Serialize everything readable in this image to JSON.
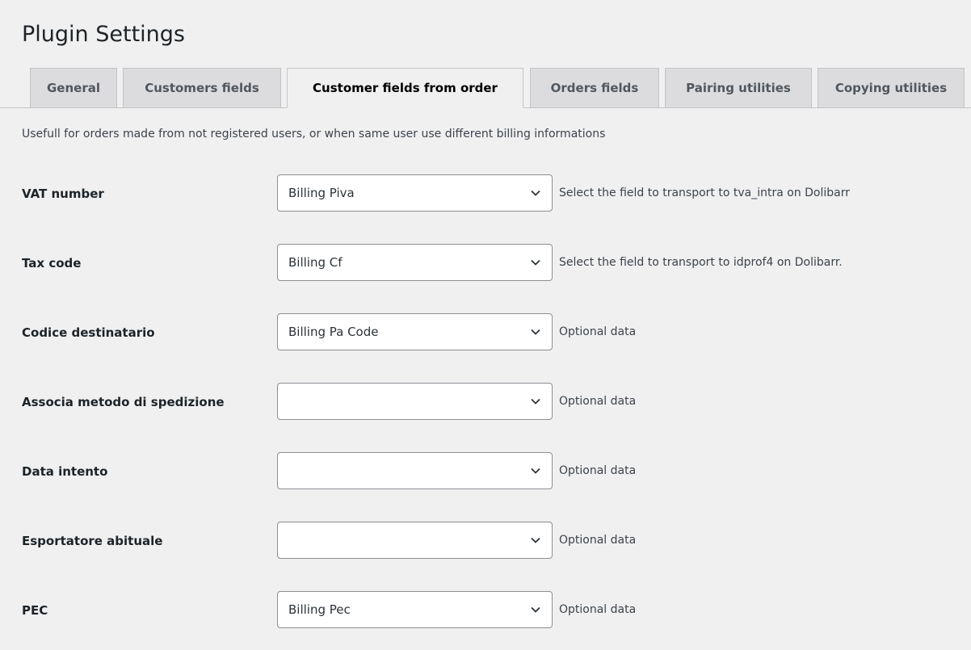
{
  "page": {
    "title": "Plugin Settings",
    "description": "Usefull for orders made from not registered users, or when same user use different billing informations"
  },
  "tabs": [
    {
      "label": "General",
      "active": false
    },
    {
      "label": "Customers fields",
      "active": false
    },
    {
      "label": "Customer fields from order",
      "active": true
    },
    {
      "label": "Orders fields",
      "active": false
    },
    {
      "label": "Pairing utilities",
      "active": false
    },
    {
      "label": "Copying utilities",
      "active": false
    }
  ],
  "fields": [
    {
      "label": "VAT number",
      "value": "Billing Piva",
      "hint": "Select the field to transport to tva_intra on Dolibarr"
    },
    {
      "label": "Tax code",
      "value": "Billing Cf",
      "hint": "Select the field to transport to idprof4 on Dolibarr."
    },
    {
      "label": "Codice destinatario",
      "value": "Billing Pa Code",
      "hint": "Optional data"
    },
    {
      "label": "Associa metodo di spedizione",
      "value": "",
      "hint": "Optional data"
    },
    {
      "label": "Data intento",
      "value": "",
      "hint": "Optional data"
    },
    {
      "label": "Esportatore abituale",
      "value": "",
      "hint": "Optional data"
    },
    {
      "label": "PEC",
      "value": "Billing Pec",
      "hint": "Optional data"
    }
  ],
  "icons": {
    "select_indicator": "chevron-down-icon"
  },
  "colors": {
    "background": "#f0f0f1",
    "tab_inactive": "#dcdcde",
    "border": "#c3c4c7",
    "select_border": "#8c8f94"
  }
}
